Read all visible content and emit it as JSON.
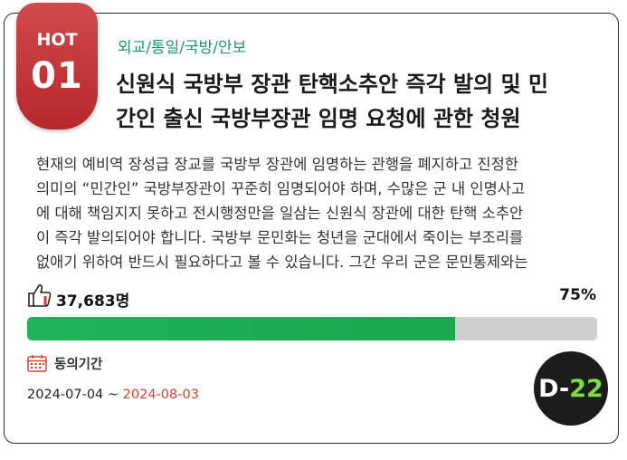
{
  "badge": {
    "label": "HOT",
    "rank": "01"
  },
  "petition": {
    "category": "외교/통일/국방/안보",
    "title_line1": "신원식 국방부 장관 탄핵소추안 즉각 발의 및 민",
    "title_line2": "간인 출신 국방부장관 임명 요청에 관한 청원",
    "description": [
      "현재의 예비역 장성급 장교를 국방부 장관에 임명하는 관행을 폐지하고 진정한",
      "의미의 “민간인” 국방부장관이 꾸준히 임명되어야 하며, 수많은 군 내 인명사고",
      "에 대해 책임지지 못하고 전시행정만을 일삼는 신원식 장관에 대한 탄핵 소추안",
      "이 즉각 발의되어야 합니다. 국방부 문민화는 청년을 군대에서 죽이는 부조리를",
      "없애기 위하여 반드시 필요하다고 볼 수 있습니다. 그간 우리 군은 문민통제와는"
    ]
  },
  "stats": {
    "agree_count": "37,683명",
    "percent_label": "75%",
    "progress": 0.75
  },
  "period": {
    "label": "동의기간",
    "start": "2024-07-04",
    "separator": " ~ ",
    "end": "2024-08-03"
  },
  "dday": {
    "prefix": "D-",
    "number": "22"
  },
  "colors": {
    "badge_red": "#b8282b",
    "category_green": "#1a9a6a",
    "progress_green": "#1fb35b",
    "end_date_red": "#d2432f",
    "dday_green": "#7cdc3c"
  },
  "icons": {
    "agree": "thumbs-up-icon",
    "period": "calendar-icon"
  }
}
